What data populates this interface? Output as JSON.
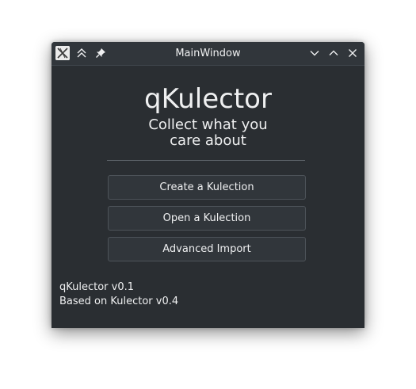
{
  "window": {
    "title": "MainWindow",
    "app_icon": "x-logo-icon",
    "titlebar_buttons": {
      "keep_above": "double-chevron-up-icon",
      "pin": "pin-icon",
      "minimize": "chevron-down-icon",
      "maximize": "chevron-up-icon",
      "close": "close-icon"
    }
  },
  "main": {
    "app_name": "qKulector",
    "tagline_line1": "Collect what you",
    "tagline_line2": "care about",
    "buttons": {
      "create": "Create a Kulection",
      "open": "Open a Kulection",
      "advanced_import": "Advanced Import"
    },
    "version_text": "qKulector v0.1",
    "based_on_text": "Based on Kulector v0.4"
  },
  "colors": {
    "window_bg": "#2a2e32",
    "titlebar_bg": "#31363b",
    "text": "#eff0f1",
    "button_bg": "#31363b",
    "button_border": "#4d5359"
  }
}
